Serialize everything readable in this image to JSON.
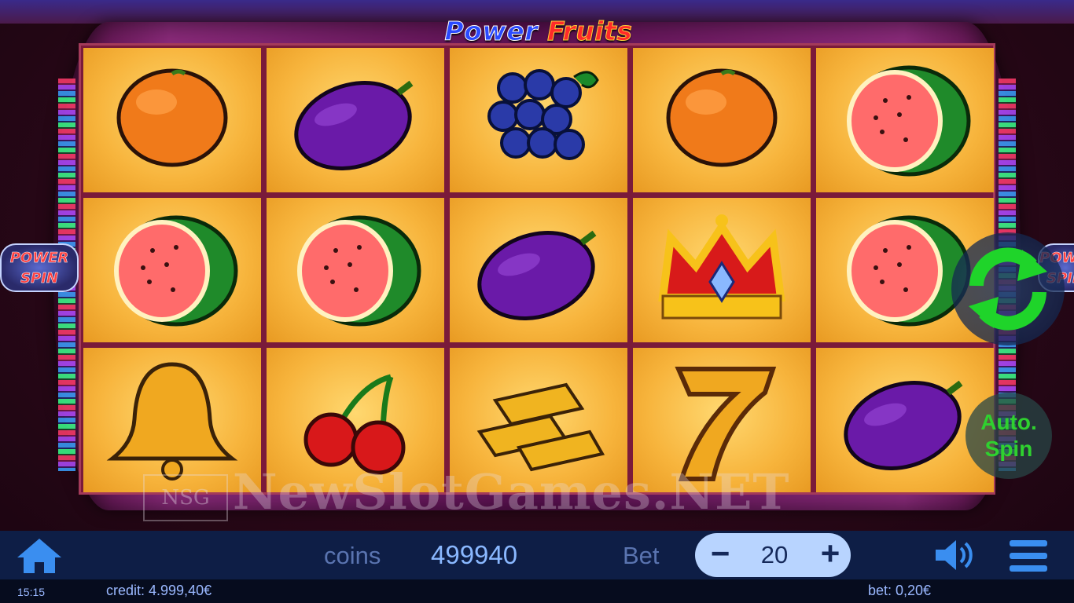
{
  "game": {
    "title_part1": "Power",
    "title_part2": "Fruits",
    "side_badge_line1": "POWER",
    "side_badge_line2": "SPIN",
    "auto_spin_line1": "Auto.",
    "auto_spin_line2": "Spin",
    "watermark": "NewSlotGames.NET",
    "watermark_logo": "NSG"
  },
  "reels": [
    [
      "orange",
      "watermelon",
      "bell"
    ],
    [
      "plum",
      "watermelon",
      "cherries"
    ],
    [
      "grapes",
      "plum",
      "gold-bars"
    ],
    [
      "orange",
      "crown",
      "seven"
    ],
    [
      "watermelon",
      "watermelon",
      "plum"
    ]
  ],
  "bottom_bar": {
    "coins_label": "coins",
    "coins_value": "499940",
    "bet_label": "Bet",
    "bet_value": "20",
    "minus": "−",
    "plus": "+"
  },
  "status_bar": {
    "time": "15:15",
    "credit": "credit: 4.999,40€",
    "bet": "bet: 0,20€"
  },
  "icons": [
    "home-icon",
    "spin-arrows-icon",
    "speaker-icon",
    "menu-icon"
  ],
  "colors": {
    "accent_green": "#2fd12f",
    "bar_background": "#0e1e46",
    "reel_gold": "#f7b43c"
  }
}
